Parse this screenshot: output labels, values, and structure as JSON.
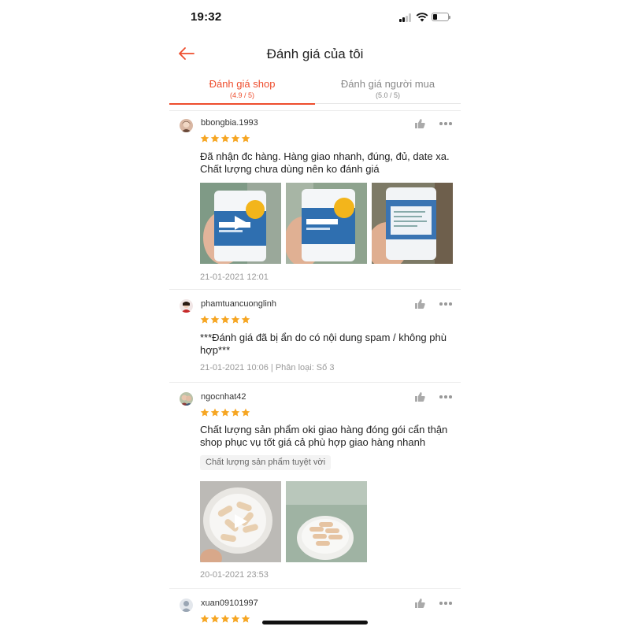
{
  "status_bar": {
    "time": "19:32",
    "battery_level": 0.3
  },
  "header": {
    "title": "Đánh giá của tôi"
  },
  "tabs": [
    {
      "label": "Đánh giá shop",
      "sub": "(4.9 / 5)",
      "active": true
    },
    {
      "label": "Đánh giá người mua",
      "sub": "(5.0 / 5)",
      "active": false
    }
  ],
  "colors": {
    "accent": "#ee4d2d",
    "star": "#f6a623",
    "muted": "#999999"
  },
  "reviews": [
    {
      "username": "bbongbia.1993",
      "rating": 5,
      "text": "Đã nhận đc hàng. Hàng giao nhanh, đúng, đủ, date xa. Chất lượng chưa dùng nên ko đánh giá",
      "meta": "21-01-2021 12:01",
      "images": [
        "video-thumbnail",
        "product-photo",
        "product-photo"
      ]
    },
    {
      "username": "phamtuancuonglinh",
      "rating": 5,
      "text": "***Đánh giá đã bị ẩn do có nội dung spam / không phù hợp***",
      "meta": "21-01-2021 10:06 | Phân loại: Số 3"
    },
    {
      "username": "ngocnhat42",
      "rating": 5,
      "text": "Chất lượng sản phẩm oki  giao hàng đóng gói cẩn thận shop phục vụ tốt giá cả phù hợp giao hàng nhanh",
      "tag": "Chất lượng sản phẩm tuyệt vời",
      "meta": "20-01-2021 23:53",
      "images": [
        "video-thumbnail",
        "product-photo"
      ]
    },
    {
      "username": "xuan09101997",
      "rating": 5
    }
  ]
}
